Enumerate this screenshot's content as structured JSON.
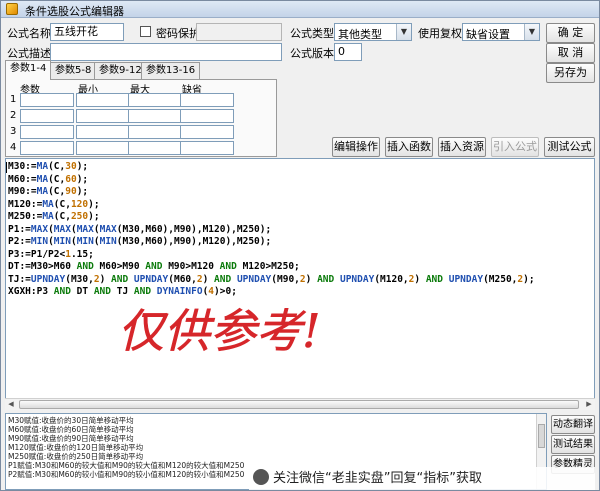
{
  "window": {
    "title": "条件选股公式编辑器"
  },
  "form": {
    "name_label": "公式名称",
    "name_value": "五线开花",
    "password_label": "密码保护",
    "password_value": "",
    "desc_label": "公式描述",
    "desc_value": "",
    "type_label": "公式类型",
    "type_value": "其他类型",
    "rights_label": "使用复权",
    "rights_value": "缺省设置",
    "version_label": "公式版本",
    "version_value": "0"
  },
  "buttons": {
    "ok": "确  定",
    "cancel": "取  消",
    "save_as": "另存为",
    "edit_ops": "编辑操作",
    "insert_func": "插入函数",
    "insert_res": "插入资源",
    "cite_formula": "引入公式",
    "test_formula": "测试公式"
  },
  "tabs": [
    "参数1-4",
    "参数5-8",
    "参数9-12",
    "参数13-16"
  ],
  "params": {
    "headers": [
      "参数",
      "最小",
      "最大",
      "缺省"
    ],
    "rows": [
      "1",
      "2",
      "3",
      "4"
    ]
  },
  "code_lines": [
    "M30:=MA(C,30);",
    "M60:=MA(C,60);",
    "M90:=MA(C,90);",
    "M120:=MA(C,120);",
    "M250:=MA(C,250);",
    "P1:=MAX(MAX(MAX(MAX(M30,M60),M90),M120),M250);",
    "P2:=MIN(MIN(MIN(MIN(M30,M60),M90),M120),M250);",
    "P3:=P1/P2<1.15;",
    "DT:=M30>M60 AND M60>M90 AND M90>M120 AND M120>M250;",
    "TJ:=UPNDAY(M30,2) AND UPNDAY(M60,2) AND UPNDAY(M90,2) AND UPNDAY(M120,2) AND UPNDAY(M250,2);",
    "XGXH:P3 AND DT AND TJ AND DYNAINFO(4)>0;"
  ],
  "stamp_text": "仅供参考!",
  "help_lines": [
    "M30赋值:收盘价的30日简单移动平均",
    "M60赋值:收盘价的60日简单移动平均",
    "M90赋值:收盘价的90日简单移动平均",
    "M120赋值:收盘价的120日简单移动平均",
    "M250赋值:收盘价的250日简单移动平均",
    "P1赋值:M30和M60的较大值和M90的较大值和M120的较大值和M250",
    "P2赋值:M30和M60的较小值和M90的较小值和M120的较小值和M250"
  ],
  "side_buttons": {
    "translate": "动态翻译",
    "test_result": "测试结果",
    "param_tune": "参数精灵"
  },
  "watermark": "关注微信“老韭实盘”回复“指标”获取"
}
